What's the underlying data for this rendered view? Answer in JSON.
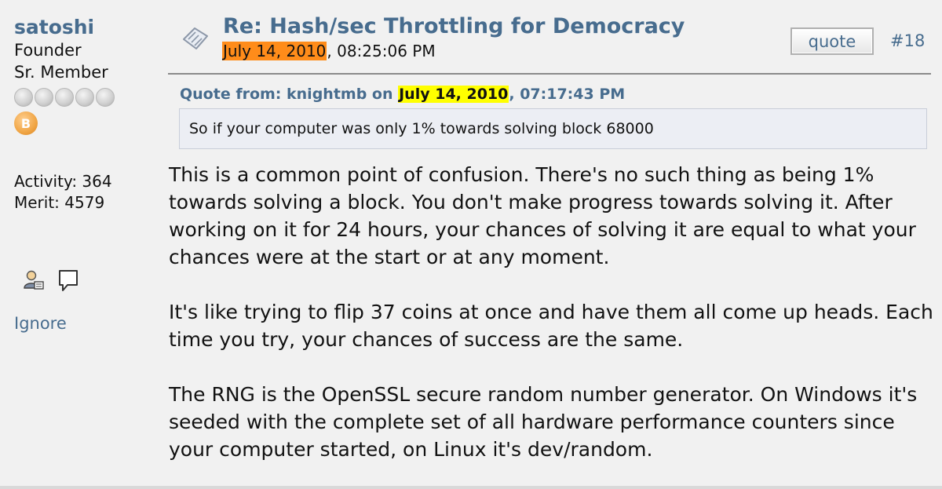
{
  "poster": {
    "name": "satoshi",
    "title": "Founder",
    "rank": "Sr. Member",
    "activity": "Activity: 364",
    "merit": "Merit: 4579",
    "ignore_label": "Ignore"
  },
  "post": {
    "title": "Re: Hash/sec Throttling for Democracy",
    "date_highlight": "July 14, 2010",
    "date_rest": ", 08:25:06 PM",
    "quote_button": "quote",
    "number": "#18"
  },
  "quote": {
    "prefix": "Quote from: knightmb on ",
    "date_highlight": "July 14, 2010",
    "date_rest": ", 07:17:43 PM",
    "text": "So if your computer was only 1% towards solving block 68000"
  },
  "body": {
    "paragraph_1": "This is a common point of confusion.  There's no such thing as being 1% towards solving a block.  You don't make progress towards solving it.  After working on it for 24 hours, your chances of solving it are equal to what your chances were at the start or at any moment.",
    "paragraph_2": "It's like trying to flip 37 coins at once and have them all come up heads.  Each time you try, your chances of success are the same.",
    "paragraph_3": "The RNG is the OpenSSL secure random number generator.  On Windows it's seeded with the complete set of all hardware performance counters since your computer started, on Linux it's dev/random."
  },
  "colors": {
    "link": "#476c8e",
    "highlight_orange": "#ff8c1a",
    "highlight_yellow": "#ffff00",
    "background": "#f1f1f1"
  },
  "icons": {
    "stars": [
      "rank-star-icon",
      "rank-star-icon",
      "rank-star-icon",
      "rank-star-icon",
      "rank-star-icon"
    ],
    "coin": "bitcoin-coin-icon",
    "profile": "profile-icon",
    "message": "message-icon",
    "post": "post-icon"
  }
}
